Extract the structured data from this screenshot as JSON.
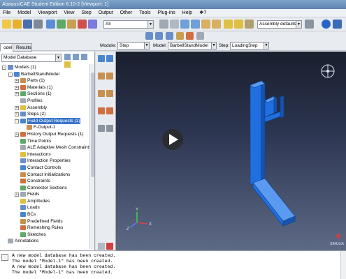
{
  "window": {
    "title": "Abaqus/CAE Student Edition 6.10-2 [Viewport: 1]"
  },
  "menu": {
    "items": [
      "File",
      "Model",
      "Viewport",
      "View",
      "Step",
      "Output",
      "Other",
      "Tools",
      "Plug-ins",
      "Help",
      "❖?"
    ]
  },
  "toolbar": {
    "filter_value": "All",
    "assembly_defaults": "Assembly defaults"
  },
  "context": {
    "module_label": "Module:",
    "module_value": "Step",
    "model_label": "Model:",
    "model_value": "BarbellStandModel",
    "step_label": "Step:",
    "step_value": "LoadingStep"
  },
  "tabs": {
    "model": "odel",
    "results": "Results"
  },
  "tree": {
    "database_select": "Model Database",
    "nodes": [
      {
        "label": "Models (1)",
        "depth": 0,
        "exp": "-"
      },
      {
        "label": "BarbellStandModel",
        "depth": 1,
        "exp": "-"
      },
      {
        "label": "Parts (1)",
        "depth": 2,
        "exp": "+"
      },
      {
        "label": "Materials (1)",
        "depth": 2,
        "exp": "+"
      },
      {
        "label": "Sections (1)",
        "depth": 2,
        "exp": "+"
      },
      {
        "label": "Profiles",
        "depth": 2,
        "exp": ""
      },
      {
        "label": "Assembly",
        "depth": 2,
        "exp": "+"
      },
      {
        "label": "Steps (2)",
        "depth": 2,
        "exp": "+"
      },
      {
        "label": "Field Output Requests (1)",
        "depth": 2,
        "exp": "-",
        "selected": true
      },
      {
        "label": "F-Output-1",
        "depth": 3,
        "exp": ""
      },
      {
        "label": "History Output Requests (1)",
        "depth": 2,
        "exp": "+"
      },
      {
        "label": "Time Points",
        "depth": 2,
        "exp": ""
      },
      {
        "label": "ALE Adaptive Mesh Constraints",
        "depth": 2,
        "exp": ""
      },
      {
        "label": "Interactions",
        "depth": 2,
        "exp": ""
      },
      {
        "label": "Interaction Properties",
        "depth": 2,
        "exp": ""
      },
      {
        "label": "Contact Controls",
        "depth": 2,
        "exp": ""
      },
      {
        "label": "Contact Initializations",
        "depth": 2,
        "exp": ""
      },
      {
        "label": "Constraints",
        "depth": 2,
        "exp": ""
      },
      {
        "label": "Connector Sections",
        "depth": 2,
        "exp": ""
      },
      {
        "label": "Fields",
        "depth": 2,
        "exp": "+"
      },
      {
        "label": "Amplitudes",
        "depth": 2,
        "exp": ""
      },
      {
        "label": "Loads",
        "depth": 2,
        "exp": ""
      },
      {
        "label": "BCs",
        "depth": 2,
        "exp": ""
      },
      {
        "label": "Predefined Fields",
        "depth": 2,
        "exp": ""
      },
      {
        "label": "Remeshing Rules",
        "depth": 2,
        "exp": ""
      },
      {
        "label": "Sketches",
        "depth": 2,
        "exp": ""
      },
      {
        "label": "Annotations",
        "depth": 0,
        "exp": ""
      }
    ]
  },
  "triad": {
    "x": "X",
    "y": "Y",
    "z": "Z"
  },
  "logo": "SIMULIA",
  "messages": [
    "A new model database has been created.",
    "The model \"Model-1\" has been created.",
    "A new model database has been created.",
    "The model \"Model-1\" has been created."
  ],
  "colors": {
    "part_blue": "#1f6fe0",
    "selection": "#3874c8"
  }
}
